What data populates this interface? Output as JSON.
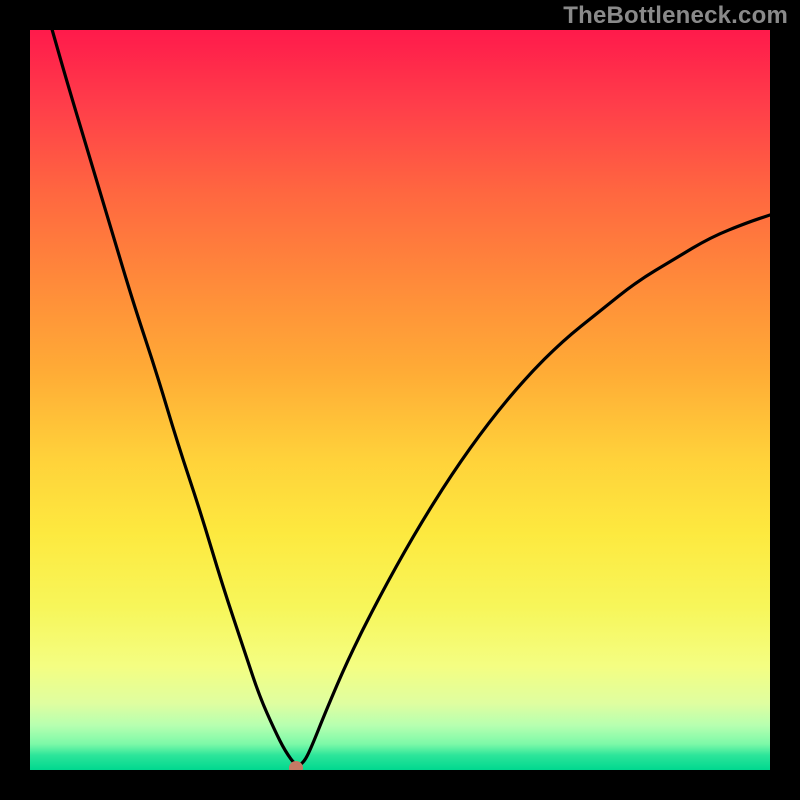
{
  "watermark": "TheBottleneck.com",
  "chart_data": {
    "type": "line",
    "title": "",
    "xlabel": "",
    "ylabel": "",
    "xlim": [
      0,
      100
    ],
    "ylim": [
      0,
      100
    ],
    "grid": false,
    "legend": false,
    "series": [
      {
        "name": "curve",
        "x": [
          3,
          5,
          8,
          11,
          14,
          17,
          20,
          23,
          26,
          29,
          31,
          33,
          34.5,
          36,
          37,
          38,
          40,
          43,
          47,
          52,
          57,
          62,
          67,
          72,
          77,
          82,
          87,
          92,
          97,
          100
        ],
        "y": [
          100,
          93,
          83,
          73,
          63,
          54,
          44,
          35,
          25,
          16,
          10,
          5.5,
          2.5,
          0.5,
          1,
          3,
          8,
          15,
          23,
          32,
          40,
          47,
          53,
          58,
          62,
          66,
          69,
          72,
          74,
          75
        ]
      }
    ],
    "marker": {
      "x": 36,
      "y": 0.3
    },
    "colors": {
      "curve": "#000000",
      "marker": "#c47a65",
      "gradient_top": "#ff1a4b",
      "gradient_bottom": "#00d88f"
    }
  }
}
